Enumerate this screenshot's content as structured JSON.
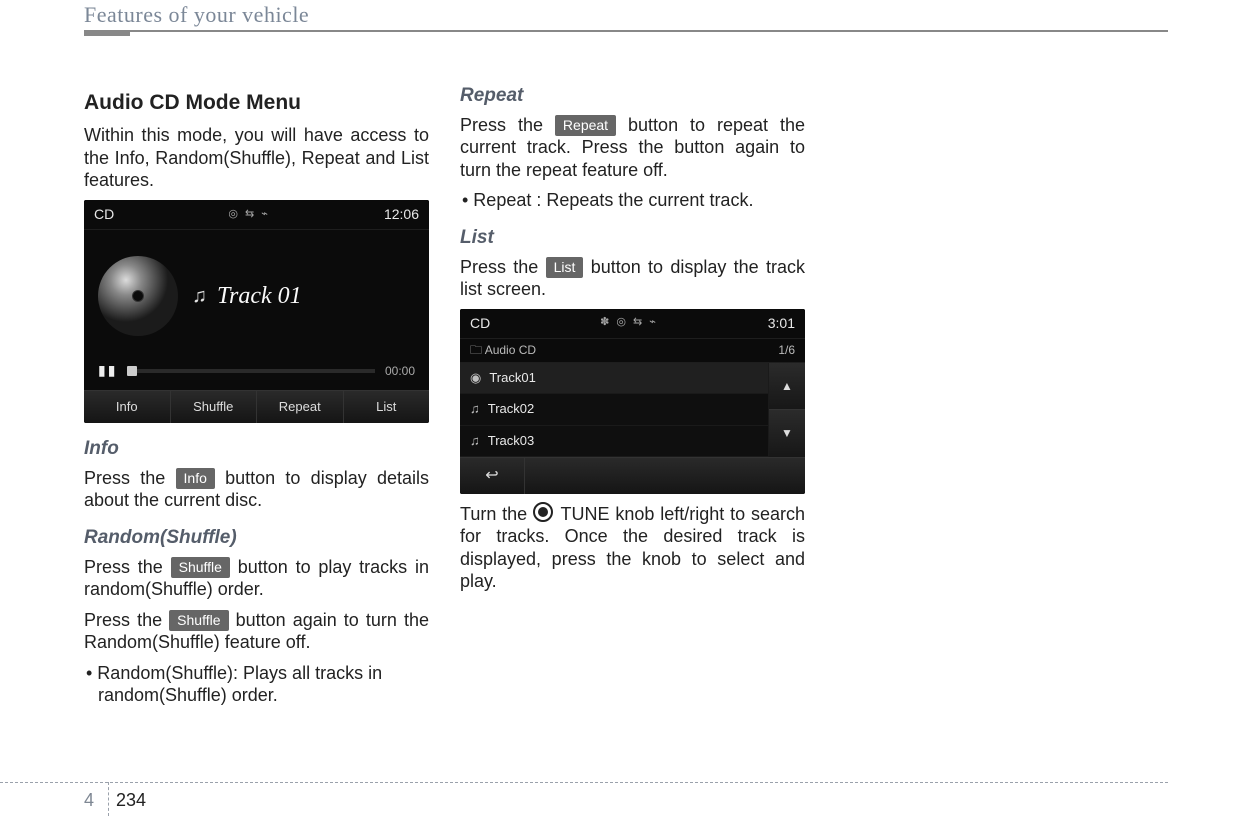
{
  "header": {
    "title": "Features of your vehicle"
  },
  "section": {
    "title": "Audio CD Mode Menu",
    "intro": "Within this mode, you will have access to the Info, Random(Shuffle), Repeat and List features."
  },
  "player": {
    "mode": "CD",
    "icons": "◎   ⇆ ⌁",
    "clock": "12:06",
    "track_label": "Track 01",
    "time": "00:00",
    "buttons": [
      "Info",
      "Shuffle",
      "Repeat",
      "List"
    ]
  },
  "info": {
    "heading": "Info",
    "text_before": "Press the ",
    "pill": "Info",
    "text_after": " button to display details about the current disc."
  },
  "shuffle": {
    "heading": "Random(Shuffle)",
    "para1_before": "Press the ",
    "pill": "Shuffle",
    "para1_after": " button to play tracks in random(Shuffle) order.",
    "para2_before": "Press the ",
    "para2_after": " button again to turn the Random(Shuffle) feature off.",
    "bullet": "• Random(Shuffle): Plays all tracks in random(Shuffle) order."
  },
  "repeat": {
    "heading": "Repeat",
    "para_before": "Press the ",
    "pill": "Repeat",
    "para_after": " button to repeat the current track. Press the button again to turn the repeat feature off.",
    "bullet": "• Repeat : Repeats the current track."
  },
  "list": {
    "heading": "List",
    "para_before": "Press the ",
    "pill": "List",
    "para_after": " button to display the track list screen."
  },
  "list_screen": {
    "mode": "CD",
    "icons": "✽ ◎   ⇆ ⌁",
    "clock": "3:01",
    "subtitle_icon": "🗀",
    "subtitle": "Audio CD",
    "counter": "1/6",
    "tracks": [
      "Track01",
      "Track02",
      "Track03"
    ],
    "back": "↩"
  },
  "tune": {
    "para_before": "Turn the ",
    "label": "TUNE",
    "para_after": " knob left/right to search for tracks. Once the desired track is displayed, press the knob to select and play."
  },
  "footer": {
    "chapter": "4",
    "page": "234"
  }
}
